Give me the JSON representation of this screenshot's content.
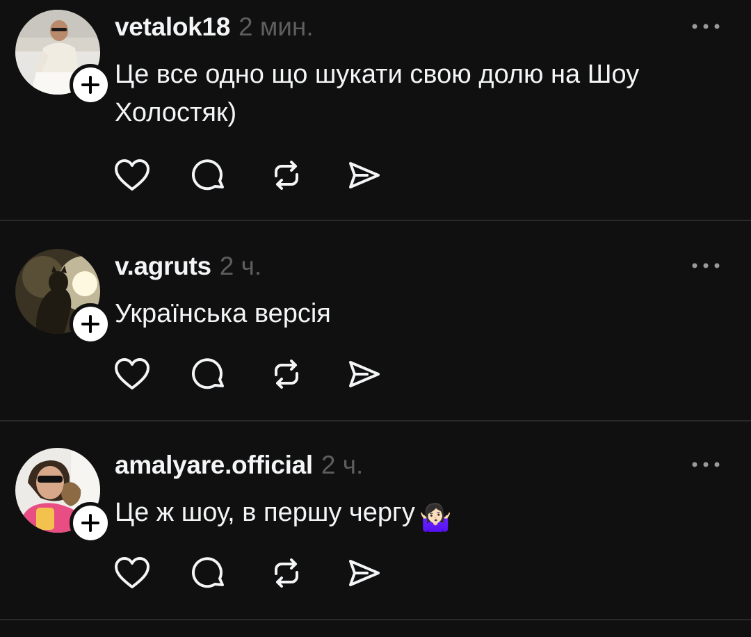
{
  "theme": {
    "background": "#101010",
    "text_primary": "#f3f5f7",
    "text_secondary": "#5e5e5e",
    "divider": "#2a2a2a",
    "icon": "#f3f5f7"
  },
  "action_icons": [
    "heart-icon",
    "comment-icon",
    "repost-icon",
    "share-icon"
  ],
  "posts": [
    {
      "username": "vetalok18",
      "timestamp": "2 мин.",
      "text": "Це все одно що шукати свою долю на Шоу Холостяк)",
      "avatar_icon": "avatar-photo"
    },
    {
      "username": "v.agruts",
      "timestamp": "2 ч.",
      "text": "Українська версія",
      "avatar_icon": "avatar-photo"
    },
    {
      "username": "amalyare.official",
      "timestamp": "2 ч.",
      "text": "Це ж шоу, в першу чергу",
      "emoji": "🤷🏻‍♀️",
      "avatar_icon": "avatar-photo"
    }
  ]
}
